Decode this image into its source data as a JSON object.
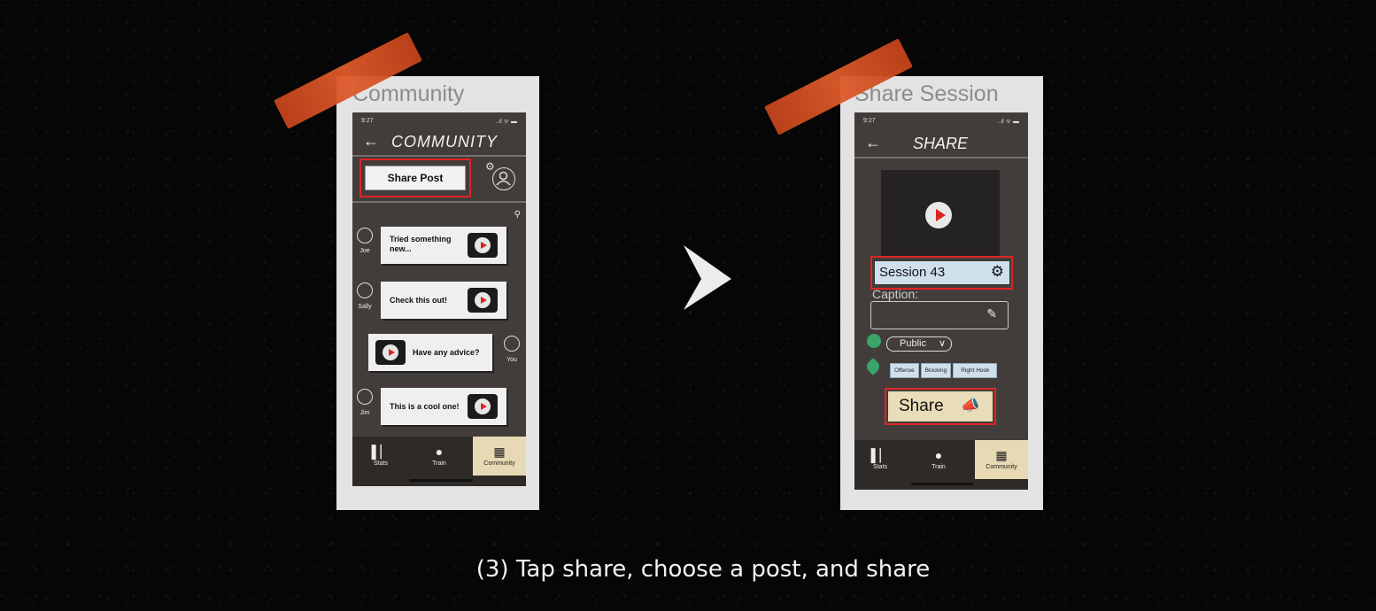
{
  "caption": "(3) Tap share, choose a post, and share",
  "left_screen": {
    "card_title": "Community",
    "status_time": "9:27",
    "status_icons": "..ıl ᯤ ▬",
    "back_icon": "arrow-left-icon",
    "appbar_title": "COMMUNITY",
    "share_post_label": "Share Post",
    "search_icon": "search-icon",
    "posts": [
      {
        "user": "Joe",
        "text": "Tried something new...",
        "side": "left"
      },
      {
        "user": "Sally",
        "text": "Check this out!",
        "side": "left"
      },
      {
        "user": "You",
        "text": "Have any advice?",
        "side": "right"
      },
      {
        "user": "Jim",
        "text": "This is a cool one!",
        "side": "left"
      }
    ],
    "tabs": [
      {
        "label": "Stats",
        "icon": "bar-chart-icon"
      },
      {
        "label": "Train",
        "icon": "bulb-icon"
      },
      {
        "label": "Community",
        "icon": "community-icon"
      }
    ],
    "active_tab": "Community"
  },
  "right_screen": {
    "card_title": "Share Session",
    "status_time": "9:27",
    "status_icons": "..ıl ᯤ ▬",
    "appbar_title": "SHARE",
    "session_name": "Session 43",
    "caption_label": "Caption:",
    "visibility": "Public",
    "tags": [
      "Offense",
      "Blocking",
      "Right Hook"
    ],
    "share_label": "Share",
    "tabs": [
      {
        "label": "Stats",
        "icon": "bar-chart-icon"
      },
      {
        "label": "Train",
        "icon": "bulb-icon"
      },
      {
        "label": "Community",
        "icon": "community-icon"
      }
    ],
    "active_tab": "Community"
  },
  "colors": {
    "background": "#050505",
    "phone": "#423d3a",
    "highlight": "#e02424",
    "active_tab": "#e7d9b4",
    "tape": "#d24e22"
  }
}
